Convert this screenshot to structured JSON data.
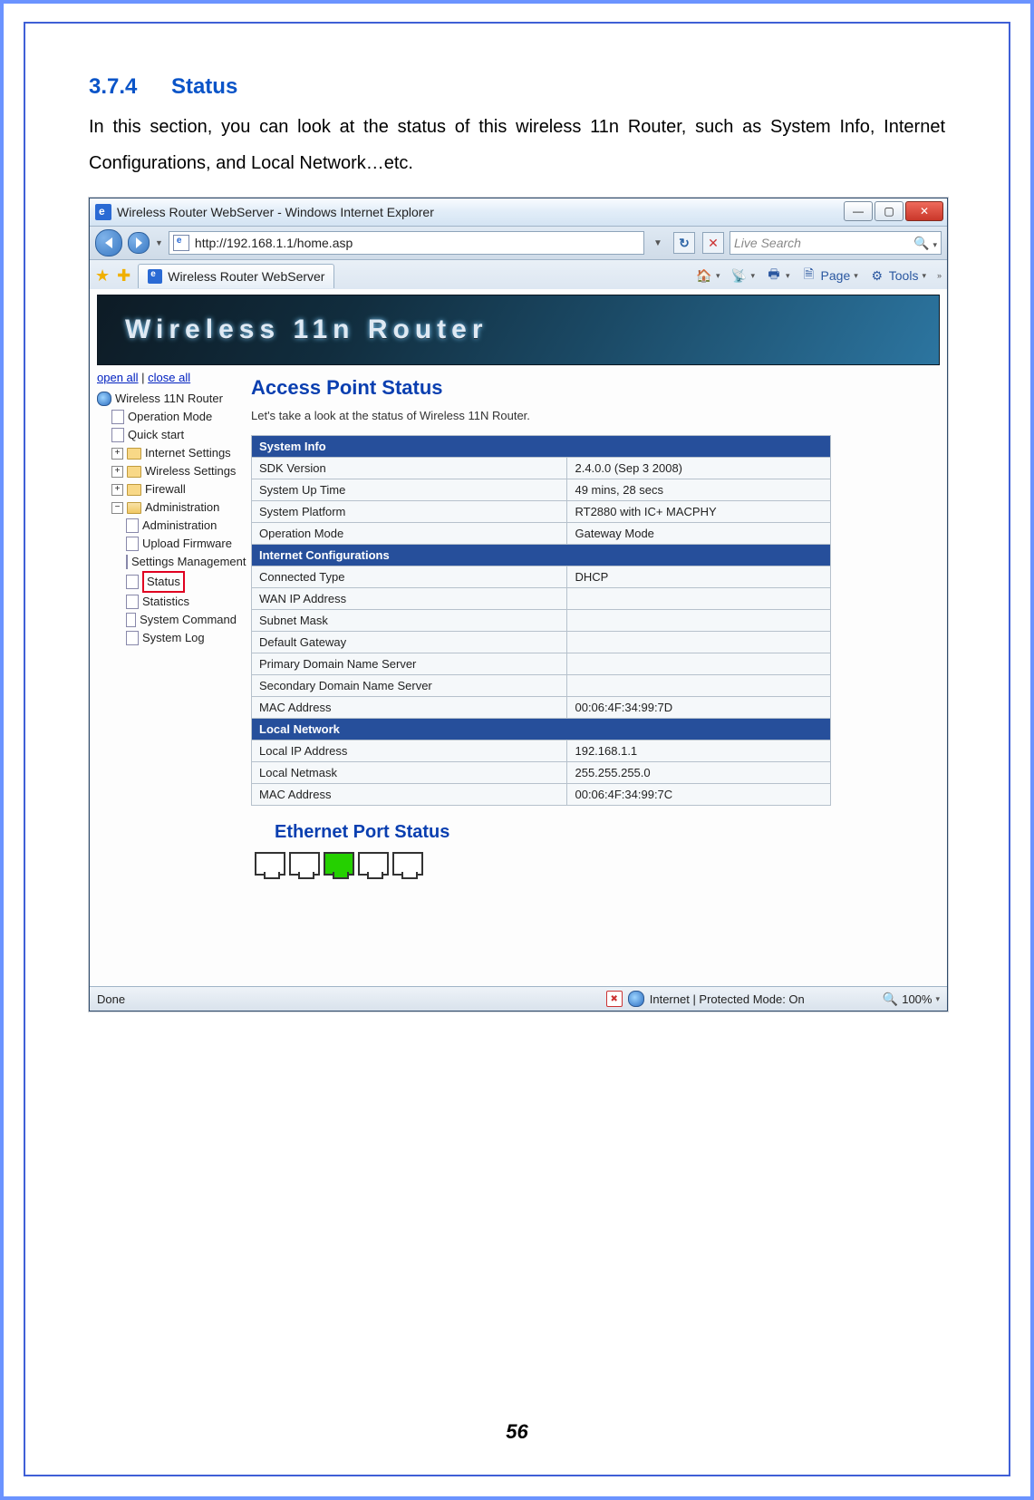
{
  "doc": {
    "section_number": "3.7.4",
    "section_title": "Status",
    "body_text": "In this section, you can look at the status of this wireless 11n Router, such as System Info, Internet Configurations, and Local Network…etc.",
    "page_number": "56"
  },
  "window_title": "Wireless Router WebServer - Windows Internet Explorer",
  "address_url": "http://192.168.1.1/home.asp",
  "search_placeholder": "Live Search",
  "tab_title": "Wireless Router WebServer",
  "cmdbar": {
    "page_label": "Page",
    "tools_label": "Tools"
  },
  "banner_text": "Wireless  11n  Router",
  "sidebar": {
    "open_all": "open all",
    "close_all": "close all",
    "root": "Wireless 11N Router",
    "items": [
      "Operation Mode",
      "Quick start",
      "Internet Settings",
      "Wireless Settings",
      "Firewall",
      "Administration"
    ],
    "admin_items": [
      "Administration",
      "Upload Firmware",
      "Settings Management",
      "Status",
      "Statistics",
      "System Command",
      "System Log"
    ]
  },
  "main": {
    "title": "Access Point Status",
    "subtitle": "Let's take a look at the status of Wireless 11N Router.",
    "sections": {
      "system_info": {
        "header": "System Info",
        "rows": [
          {
            "label": "SDK Version",
            "value": "2.4.0.0 (Sep 3 2008)"
          },
          {
            "label": "System Up Time",
            "value": "49 mins, 28 secs"
          },
          {
            "label": "System Platform",
            "value": "RT2880 with IC+ MACPHY"
          },
          {
            "label": "Operation Mode",
            "value": "Gateway Mode"
          }
        ]
      },
      "internet": {
        "header": "Internet Configurations",
        "rows": [
          {
            "label": "Connected Type",
            "value": "DHCP"
          },
          {
            "label": "WAN IP Address",
            "value": ""
          },
          {
            "label": "Subnet Mask",
            "value": ""
          },
          {
            "label": "Default Gateway",
            "value": ""
          },
          {
            "label": "Primary Domain Name Server",
            "value": ""
          },
          {
            "label": "Secondary Domain Name Server",
            "value": ""
          },
          {
            "label": "MAC Address",
            "value": "00:06:4F:34:99:7D"
          }
        ]
      },
      "local": {
        "header": "Local Network",
        "rows": [
          {
            "label": "Local IP Address",
            "value": "192.168.1.1"
          },
          {
            "label": "Local Netmask",
            "value": "255.255.255.0"
          },
          {
            "label": "MAC Address",
            "value": "00:06:4F:34:99:7C"
          }
        ]
      }
    },
    "ethernet_title": "Ethernet Port Status",
    "ports": [
      false,
      false,
      true,
      false,
      false
    ]
  },
  "statusbar": {
    "left": "Done",
    "mode": "Internet | Protected Mode: On",
    "zoom": "100%"
  }
}
